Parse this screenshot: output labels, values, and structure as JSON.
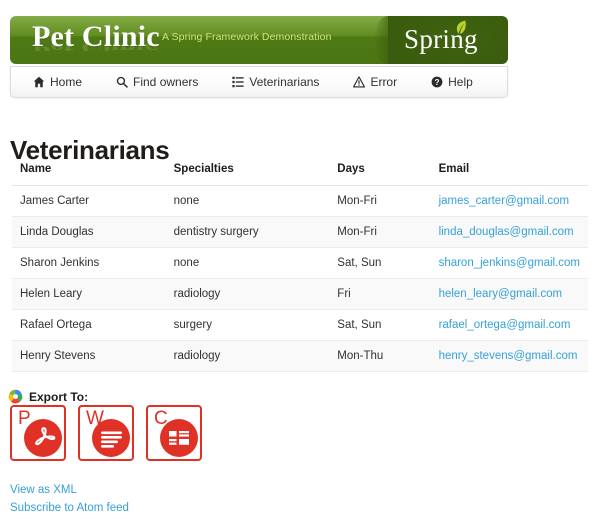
{
  "header": {
    "brand": "Pet Clinic",
    "tagline": "A Spring Framework Demonstration",
    "spring_logo_text": "Spring",
    "leaf_icon": "leaf-icon",
    "colors": {
      "banner_green": "#5d8a1c",
      "spring_block_green": "#3a5c0e",
      "tagline_color": "#cfe07f"
    }
  },
  "nav": {
    "items": [
      {
        "label": "Home",
        "icon": "home-icon"
      },
      {
        "label": "Find owners",
        "icon": "search-icon"
      },
      {
        "label": "Veterinarians",
        "icon": "list-icon"
      },
      {
        "label": "Error",
        "icon": "warning-triangle-icon"
      },
      {
        "label": "Help",
        "icon": "question-circle-icon"
      }
    ]
  },
  "main": {
    "title": "Veterinarians",
    "table": {
      "columns": [
        "Name",
        "Specialties",
        "Days",
        "Email"
      ],
      "rows": [
        {
          "name": "James Carter",
          "specialties": "none",
          "days": "Mon-Fri",
          "email": "james_carter@gmail.com"
        },
        {
          "name": "Linda Douglas",
          "specialties": "dentistry surgery",
          "days": "Mon-Fri",
          "email": "linda_douglas@gmail.com"
        },
        {
          "name": "Sharon Jenkins",
          "specialties": "none",
          "days": "Sat, Sun",
          "email": "sharon_jenkins@gmail.com"
        },
        {
          "name": "Helen Leary",
          "specialties": "radiology",
          "days": "Fri",
          "email": "helen_leary@gmail.com"
        },
        {
          "name": "Rafael Ortega",
          "specialties": "surgery",
          "days": "Sat, Sun",
          "email": "rafael_ortega@gmail.com"
        },
        {
          "name": "Henry Stevens",
          "specialties": "radiology",
          "days": "Mon-Thu",
          "email": "henry_stevens@gmail.com"
        }
      ]
    }
  },
  "export": {
    "label": "Export To:",
    "spiral_icon": "spiral-export-icon",
    "accent_color": "#e03127",
    "icons": [
      {
        "letter": "P",
        "name": "export-pdf-icon"
      },
      {
        "letter": "W",
        "name": "export-word-icon"
      },
      {
        "letter": "C",
        "name": "export-csv-icon"
      }
    ]
  },
  "footer": {
    "links": [
      {
        "label": "View as XML"
      },
      {
        "label": "Subscribe to Atom feed"
      }
    ],
    "link_color": "#34a1d8"
  }
}
